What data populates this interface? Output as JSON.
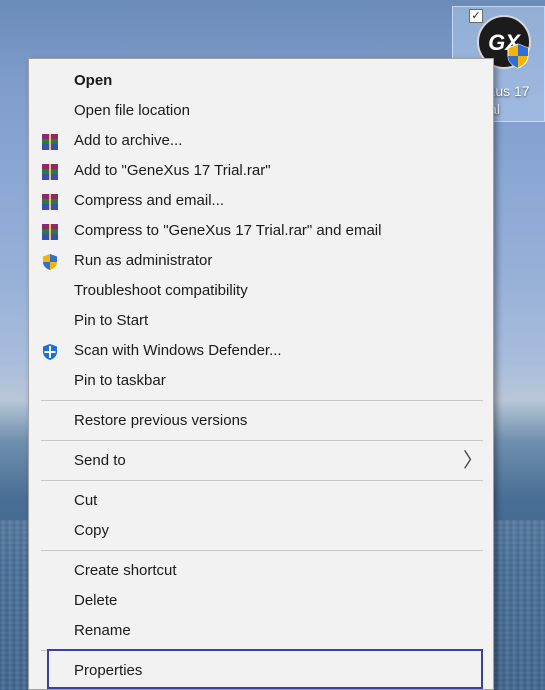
{
  "desktop_icon": {
    "logo_text": "GX",
    "label_line1": "Xus 17",
    "label_line2": "ial"
  },
  "menu": {
    "items": [
      {
        "label": "Open",
        "icon": "none"
      },
      {
        "label": "Open file location",
        "icon": "none"
      },
      {
        "label": "Add to archive...",
        "icon": "winrar-icon"
      },
      {
        "label": "Add to \"GeneXus 17 Trial.rar\"",
        "icon": "winrar-icon"
      },
      {
        "label": "Compress and email...",
        "icon": "winrar-icon"
      },
      {
        "label": "Compress to \"GeneXus 17 Trial.rar\" and email",
        "icon": "winrar-icon"
      },
      {
        "label": "Run as administrator",
        "icon": "uac-shield-icon"
      },
      {
        "label": "Troubleshoot compatibility",
        "icon": "none"
      },
      {
        "label": "Pin to Start",
        "icon": "none"
      },
      {
        "label": "Scan with Windows Defender...",
        "icon": "windows-defender-icon"
      },
      {
        "label": "Pin to taskbar",
        "icon": "none"
      },
      {
        "label": "Restore previous versions",
        "icon": "none"
      },
      {
        "label": "Send to",
        "icon": "none",
        "submenu_arrow": "〉"
      },
      {
        "label": "Cut",
        "icon": "none"
      },
      {
        "label": "Copy",
        "icon": "none"
      },
      {
        "label": "Create shortcut",
        "icon": "none"
      },
      {
        "label": "Delete",
        "icon": "none"
      },
      {
        "label": "Rename",
        "icon": "none"
      },
      {
        "label": "Properties",
        "icon": "none"
      }
    ]
  },
  "colors": {
    "menu_background": "#f2f2f2",
    "highlight_border": "#3d3fa0",
    "separator": "#c8c8c8"
  }
}
